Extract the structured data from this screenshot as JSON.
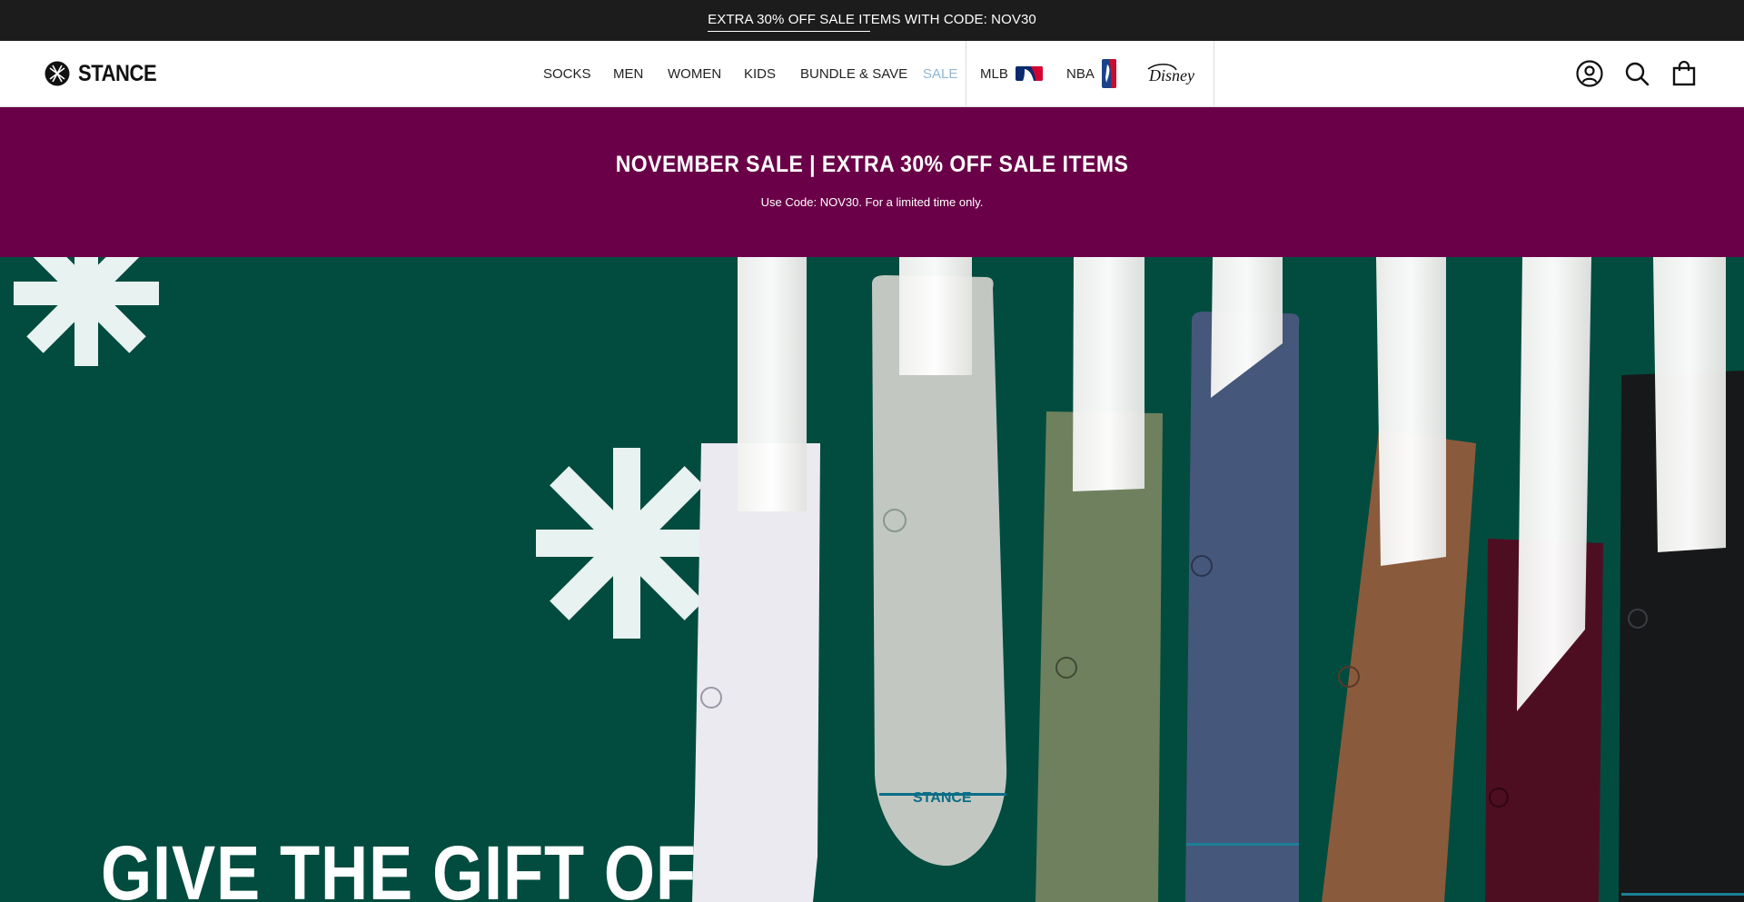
{
  "announcement": {
    "text": "EXTRA 30% OFF SALE ITEMS WITH CODE: NOV30"
  },
  "header": {
    "brand": "STANCE",
    "nav": [
      {
        "label": "SOCKS"
      },
      {
        "label": "MEN"
      },
      {
        "label": "WOMEN"
      },
      {
        "label": "KIDS"
      },
      {
        "label": "BUNDLE & SAVE"
      },
      {
        "label": "SALE"
      },
      {
        "label": "MLB"
      },
      {
        "label": "NBA"
      }
    ],
    "icons": [
      "user-icon",
      "search-icon",
      "bag-icon"
    ]
  },
  "promo": {
    "title": "NOVEMBER SALE | EXTRA 30% OFF SALE ITEMS",
    "subtitle": "Use Code: NOV30. For a limited time only."
  },
  "hero": {
    "headline": "GIVE THE GIFT OF",
    "sock_brand_text": "STANCE"
  },
  "colors": {
    "announcement_bg": "#1c1c1c",
    "promo_bg": "#6a0048",
    "hero_bg": "#014c3e",
    "sale_link": "#8fb6cf"
  }
}
